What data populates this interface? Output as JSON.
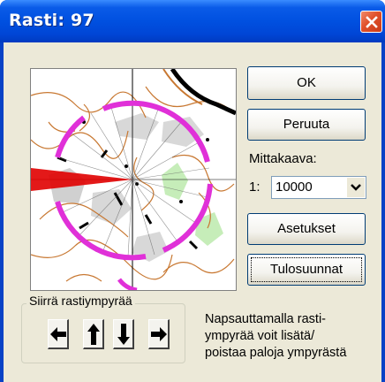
{
  "window": {
    "title": "Rasti: 97",
    "close_icon": "close-x-icon"
  },
  "buttons": {
    "ok": "OK",
    "cancel": "Peruuta",
    "settings": "Asetukset",
    "print_directions": "Tulosuunnat"
  },
  "scale": {
    "label": "Mittakaava:",
    "prefix": "1:",
    "value": "10000"
  },
  "move_group": {
    "title": "Siirrä rastiympyrää",
    "arrows": [
      "arrow-left-icon",
      "arrow-up-icon",
      "arrow-down-icon",
      "arrow-right-icon"
    ]
  },
  "help": {
    "lines": [
      "Napsauttamalla rasti-",
      "ympyrää voit lisätä/",
      "poistaa paloja ympyrästä"
    ]
  },
  "colors": {
    "titlebar": "#0050e0",
    "circle": "#e030d8",
    "leg_line": "#e00000",
    "contour": "#c87832",
    "vegetation": "#b8e8a8"
  }
}
